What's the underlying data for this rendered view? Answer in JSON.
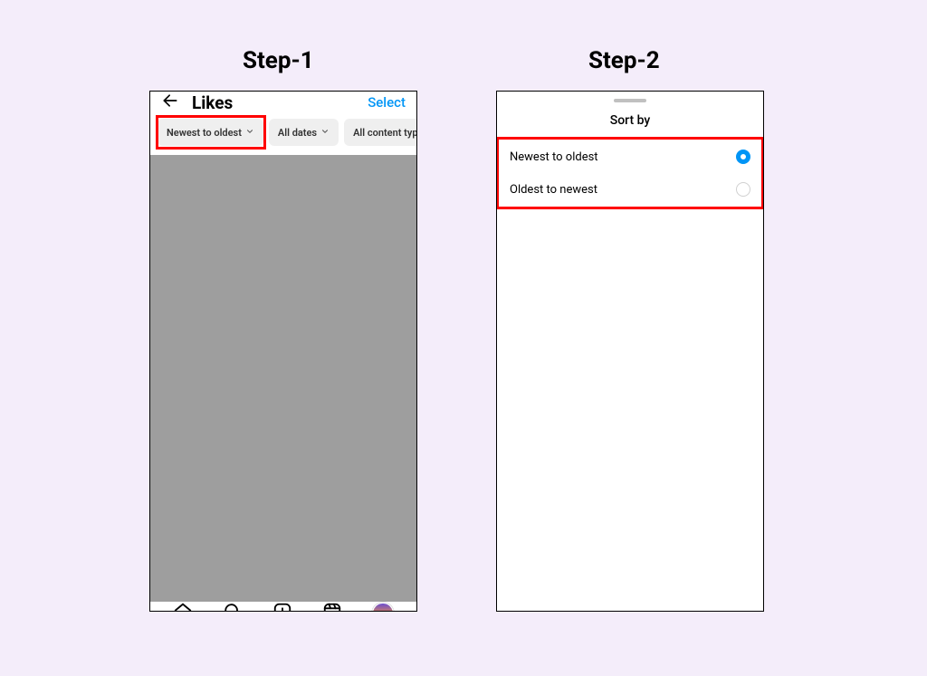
{
  "steps": {
    "one": "Step-1",
    "two": "Step-2"
  },
  "phone1": {
    "header": {
      "title": "Likes",
      "select": "Select"
    },
    "filters": {
      "sort": "Newest to oldest",
      "dates": "All dates",
      "types": "All content types"
    }
  },
  "phone2": {
    "title": "Sort by",
    "options": [
      {
        "label": "Newest to oldest",
        "selected": true
      },
      {
        "label": "Oldest to newest",
        "selected": false
      }
    ]
  }
}
